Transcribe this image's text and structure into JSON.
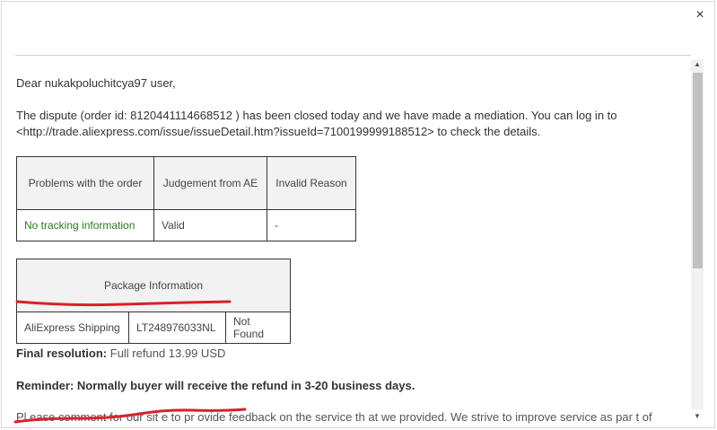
{
  "dialog": {
    "close_glyph": "×"
  },
  "email": {
    "greeting": "Dear nukakpoluchitcya97 user,",
    "dispute_line1": "The dispute (order id: 8120441114668512 ) has been closed today and we have made a mediation. You can log in to",
    "dispute_line2": "<http://trade.aliexpress.com/issue/issueDetail.htm?issueId=7100199999188512> to check the details.",
    "issue_table": {
      "headers": [
        "Problems with the order",
        "Judgement from AE",
        "Invalid Reason"
      ],
      "row": [
        "No tracking information",
        "Valid",
        "-"
      ]
    },
    "package_table": {
      "header": "Package Information",
      "row": [
        "AliExpress Shipping",
        "LT248976033NL",
        "Not Found"
      ]
    },
    "final_label": "Final resolution:",
    "final_value": "Full refund  13.99 USD",
    "reminder": "Reminder: Normally buyer will receive the refund in 3-20 business days.",
    "cut_off_text": "Pl ease comment for our sit e to pr ovide feedback on the service  th at we provided.  We strive to improve service  as par t of"
  },
  "colors": {
    "annotation_red": "#d9212a",
    "green_text": "#2a7a1a"
  }
}
